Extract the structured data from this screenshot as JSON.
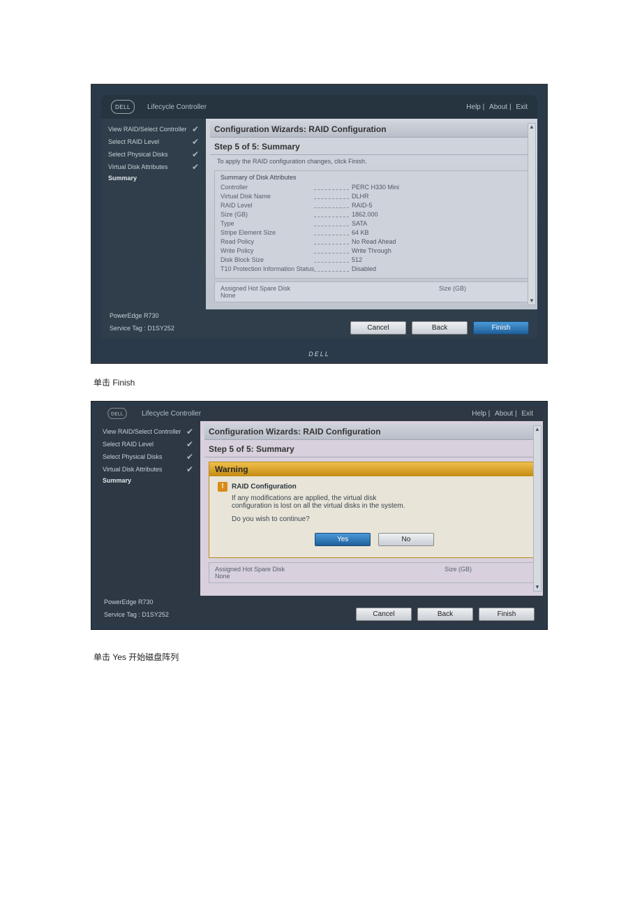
{
  "toplinks": {
    "help": "Help",
    "about": "About",
    "exit": "Exit"
  },
  "logo_text": "DELL",
  "app_title": "Lifecycle Controller",
  "sidebar": {
    "items": [
      {
        "label": "View RAID/Select Controller",
        "done": true
      },
      {
        "label": "Select RAID Level",
        "done": true
      },
      {
        "label": "Select Physical Disks",
        "done": true
      },
      {
        "label": "Virtual Disk Attributes",
        "done": true
      },
      {
        "label": "Summary",
        "current": true
      }
    ]
  },
  "panel": {
    "title": "Configuration Wizards: RAID Configuration",
    "step_label": "Step 5 of 5: Summary",
    "hint": "To apply the RAID configuration changes, click Finish.",
    "attr_header": "Summary of Disk Attributes",
    "attrs": [
      {
        "k": "Controller",
        "v": "PERC H330 Mini"
      },
      {
        "k": "Virtual Disk Name",
        "v": "DLHR"
      },
      {
        "k": "RAID Level",
        "v": "RAID-5"
      },
      {
        "k": "Size (GB)",
        "v": "1862.000"
      },
      {
        "k": "Type",
        "v": "SATA"
      },
      {
        "k": "Stripe Element Size",
        "v": "64 KB"
      },
      {
        "k": "Read Policy",
        "v": "No Read Ahead"
      },
      {
        "k": "Write Policy",
        "v": "Write Through"
      },
      {
        "k": "Disk Block Size",
        "v": "512"
      },
      {
        "k": "T10 Protection Information Status",
        "v": "Disabled"
      }
    ],
    "spare": {
      "title": "Assigned Hot Spare Disk",
      "value": "None",
      "size_label": "Size (GB)"
    }
  },
  "footer": {
    "model": "PowerEdge R730",
    "service_tag": "Service Tag : D1SY252",
    "cancel": "Cancel",
    "back": "Back",
    "finish": "Finish"
  },
  "caption1": "单击 Finish",
  "warning": {
    "title": "Warning",
    "sub": "RAID Configuration",
    "msg1": "If any modifications are applied, the virtual disk configuration is lost on all the virtual disks in the system.",
    "msg2": "Do you wish to continue?",
    "yes": "Yes",
    "no": "No"
  },
  "caption2": "单击 Yes 开始磁盘阵列",
  "brand_strip": "DELL"
}
